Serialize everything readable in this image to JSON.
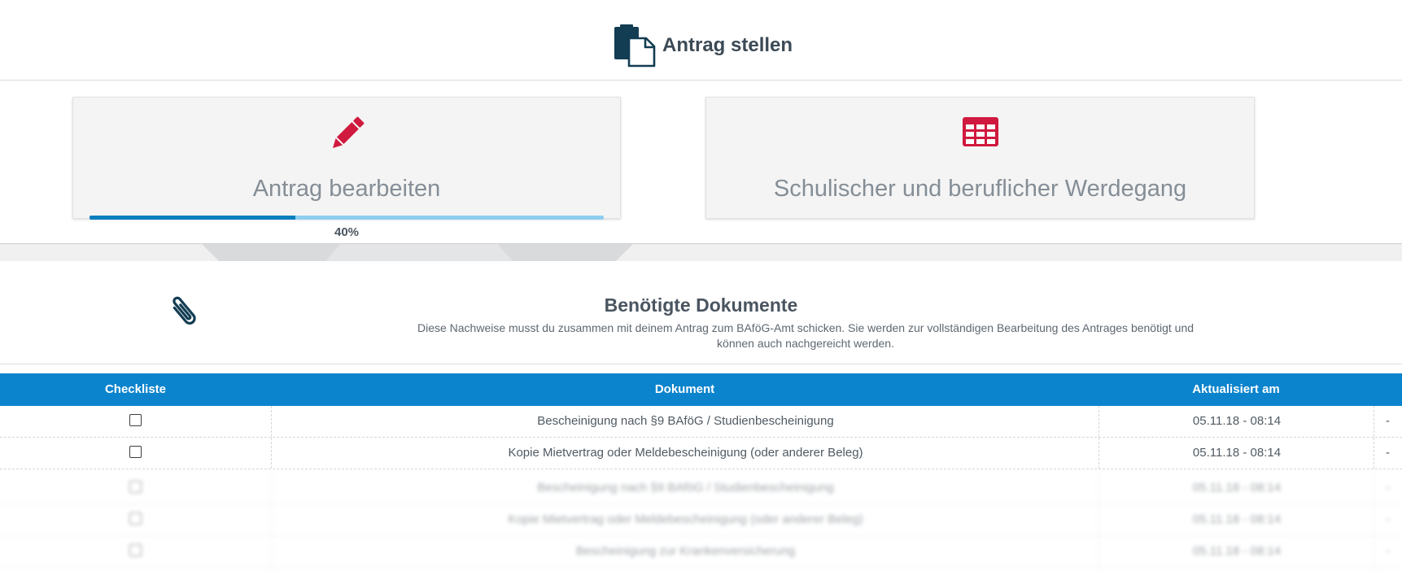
{
  "header": {
    "title": "Antrag stellen",
    "icon": "documents-icon"
  },
  "cards": [
    {
      "title": "Antrag bearbeiten",
      "icon": "pencil-icon",
      "progress_percent": 40,
      "progress_label": "40%"
    },
    {
      "title": "Schulischer und beruflicher Werdegang",
      "icon": "table-icon"
    }
  ],
  "documents": {
    "icon": "paperclip-icon",
    "title": "Benötigte Dokumente",
    "description_line1": "Diese Nachweise musst du zusammen mit deinem Antrag zum BAföG-Amt schicken. Sie werden zur vollständigen Bearbeitung des Antrages benötigt und",
    "description_line2": "können auch nachgereicht werden."
  },
  "table": {
    "columns": {
      "checklist": "Checkliste",
      "document": "Dokument",
      "updated": "Aktualisiert am"
    },
    "rows": [
      {
        "document": "Bescheinigung nach §9 BAföG / Studienbescheinigung",
        "updated": "05.11.18 - 08:14",
        "action": "-"
      },
      {
        "document": "Kopie Mietvertrag oder Meldebescheinigung (oder anderer Beleg)",
        "updated": "05.11.18 - 08:14",
        "action": "-"
      },
      {
        "document": "Bescheinigung nach §9 BAföG / Studienbescheinigung",
        "updated": "05.11.18 - 08:14",
        "action": "-"
      },
      {
        "document": "Kopie Mietvertrag oder Meldebescheinigung (oder anderer Beleg)",
        "updated": "05.11.18 - 08:14",
        "action": "-"
      },
      {
        "document": "Bescheinigung zur Krankenversicherung",
        "updated": "05.11.18 - 08:14",
        "action": "-"
      }
    ]
  },
  "colors": {
    "primary_blue": "#0b84cd",
    "accent_red": "#d0193e",
    "dark_navy": "#123d52",
    "progress_light": "#8fcdf0",
    "progress_dark": "#0a7fbf"
  }
}
